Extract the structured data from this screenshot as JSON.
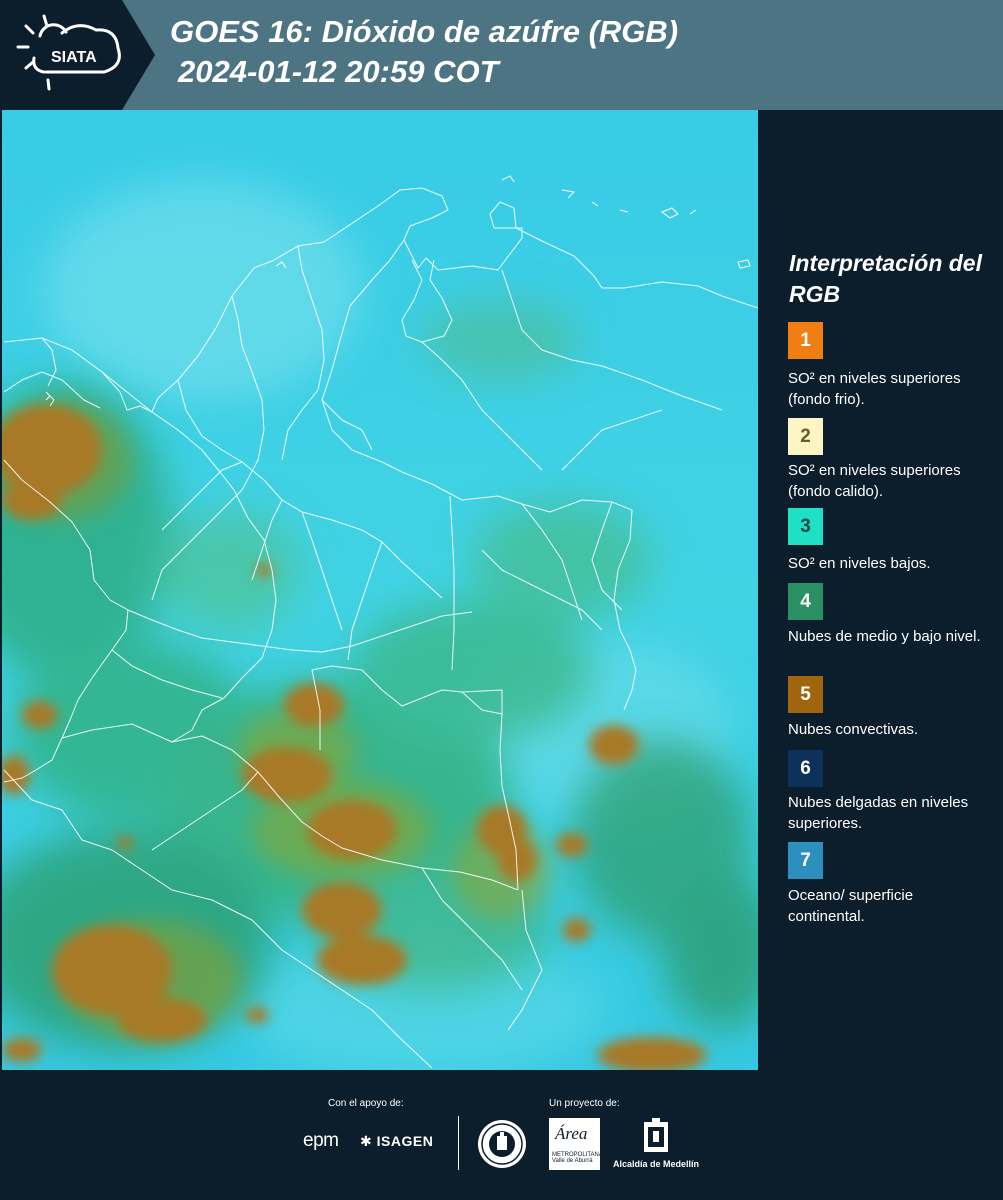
{
  "header": {
    "logo_text": "SIATA",
    "title_line1": "GOES 16: Dióxido de azúfre (RGB)",
    "title_line2": "2024-01-12 20:59 COT"
  },
  "map": {
    "product": "GOES 16 Sulfur Dioxide RGB",
    "background_color": "#34c8e0"
  },
  "legend": {
    "title": "Interpretación del RGB",
    "items": [
      {
        "number": "1",
        "color": "#f07e12",
        "text": "SO² en niveles superiores (fondo frio)."
      },
      {
        "number": "2",
        "color": "#fdf5c4",
        "text": "SO² en niveles superiores (fondo calido)."
      },
      {
        "number": "3",
        "color": "#1ee0c4",
        "text": "SO² en niveles bajos."
      },
      {
        "number": "4",
        "color": "#2a9062",
        "text": "Nubes de medio y bajo nivel."
      },
      {
        "number": "5",
        "color": "#a0650d",
        "text": "Nubes convectivas."
      },
      {
        "number": "6",
        "color": "#0c325c",
        "text": "Nubes delgadas en niveles superiores."
      },
      {
        "number": "7",
        "color": "#2c8fbd",
        "text": "Oceano/ superficie continental."
      }
    ]
  },
  "footer": {
    "support_label": "Con el apoyo de:",
    "project_label": "Un proyecto de:",
    "epm": "epm",
    "isagen": "ISAGEN",
    "area_logo_text": "Área",
    "area_logo_sub": "METROPOLITANA Valle de Aburrá",
    "alcaldia": "Alcaldía de Medellín"
  }
}
